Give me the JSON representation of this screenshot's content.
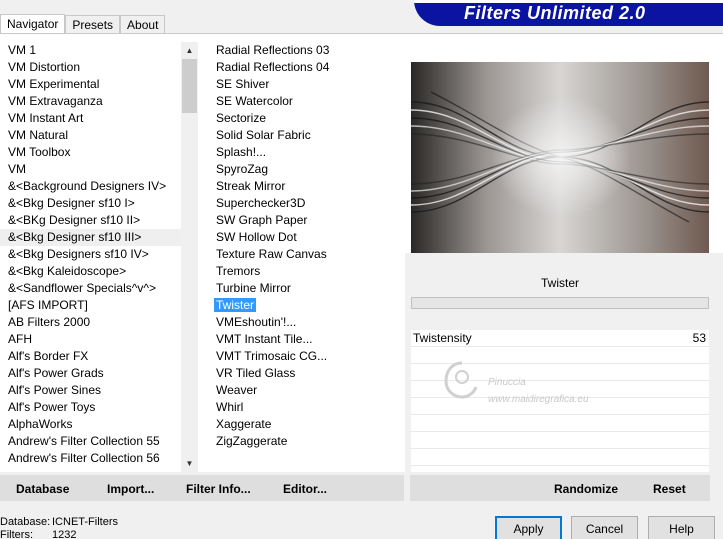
{
  "banner": {
    "title": "Filters Unlimited 2.0"
  },
  "tabs": [
    {
      "label": "Navigator"
    },
    {
      "label": "Presets"
    },
    {
      "label": "About"
    }
  ],
  "categories": {
    "items": [
      "VM 1",
      "VM Distortion",
      "VM Experimental",
      "VM Extravaganza",
      "VM Instant Art",
      "VM Natural",
      "VM Toolbox",
      "VM",
      "&<Background Designers IV>",
      "&<Bkg Designer sf10 I>",
      "&<BKg Designer sf10 II>",
      "&<Bkg Designer sf10 III>",
      "&<Bkg Designers sf10 IV>",
      "&<Bkg Kaleidoscope>",
      "&<Sandflower Specials^v^>",
      "[AFS IMPORT]",
      "AB Filters 2000",
      "AFH",
      "Alf's Border FX",
      "Alf's Power Grads",
      "Alf's Power Sines",
      "Alf's Power Toys",
      "AlphaWorks",
      "Andrew's Filter Collection 55",
      "Andrew's Filter Collection 56"
    ],
    "highlighted": "&<Bkg Designer sf10 III>"
  },
  "filters": {
    "items": [
      "Radial Reflections 03",
      "Radial Reflections 04",
      "SE Shiver",
      "SE Watercolor",
      "Sectorize",
      "Solid Solar Fabric",
      "Splash!...",
      "SpyroZag",
      "Streak Mirror",
      "Superchecker3D",
      "SW Graph Paper",
      "SW Hollow Dot",
      "Texture Raw Canvas",
      "Tremors",
      "Turbine Mirror",
      "Twister",
      "VMEshoutin'!...",
      "VMT Instant Tile...",
      "VMT Trimosaic CG...",
      "VR Tiled Glass",
      "Weaver",
      "Whirl",
      "Xaggerate",
      "ZigZaggerate"
    ],
    "selected": "Twister"
  },
  "scrollbar": {
    "up_glyph": "▲",
    "down_glyph": "▼"
  },
  "filter_panel": {
    "filter_name": "Twister"
  },
  "params": [
    {
      "label": "Twistensity",
      "value": "53"
    }
  ],
  "watermark": {
    "line1": "Pinuccia",
    "line2": "www.maidiregrafica.eu"
  },
  "left_buttons": {
    "database": "Database",
    "import": "Import...",
    "filter_info": "Filter Info...",
    "editor": "Editor..."
  },
  "right_buttons": {
    "randomize": "Randomize",
    "reset": "Reset"
  },
  "status": {
    "database_label": "Database:",
    "database_value": "ICNET-Filters",
    "filters_label": "Filters:",
    "filters_value": "1232"
  },
  "dialog": {
    "apply": "Apply",
    "cancel": "Cancel",
    "help": "Help"
  },
  "colors": {
    "banner_bg": "#0a14a0",
    "selection": "#3399ff"
  }
}
